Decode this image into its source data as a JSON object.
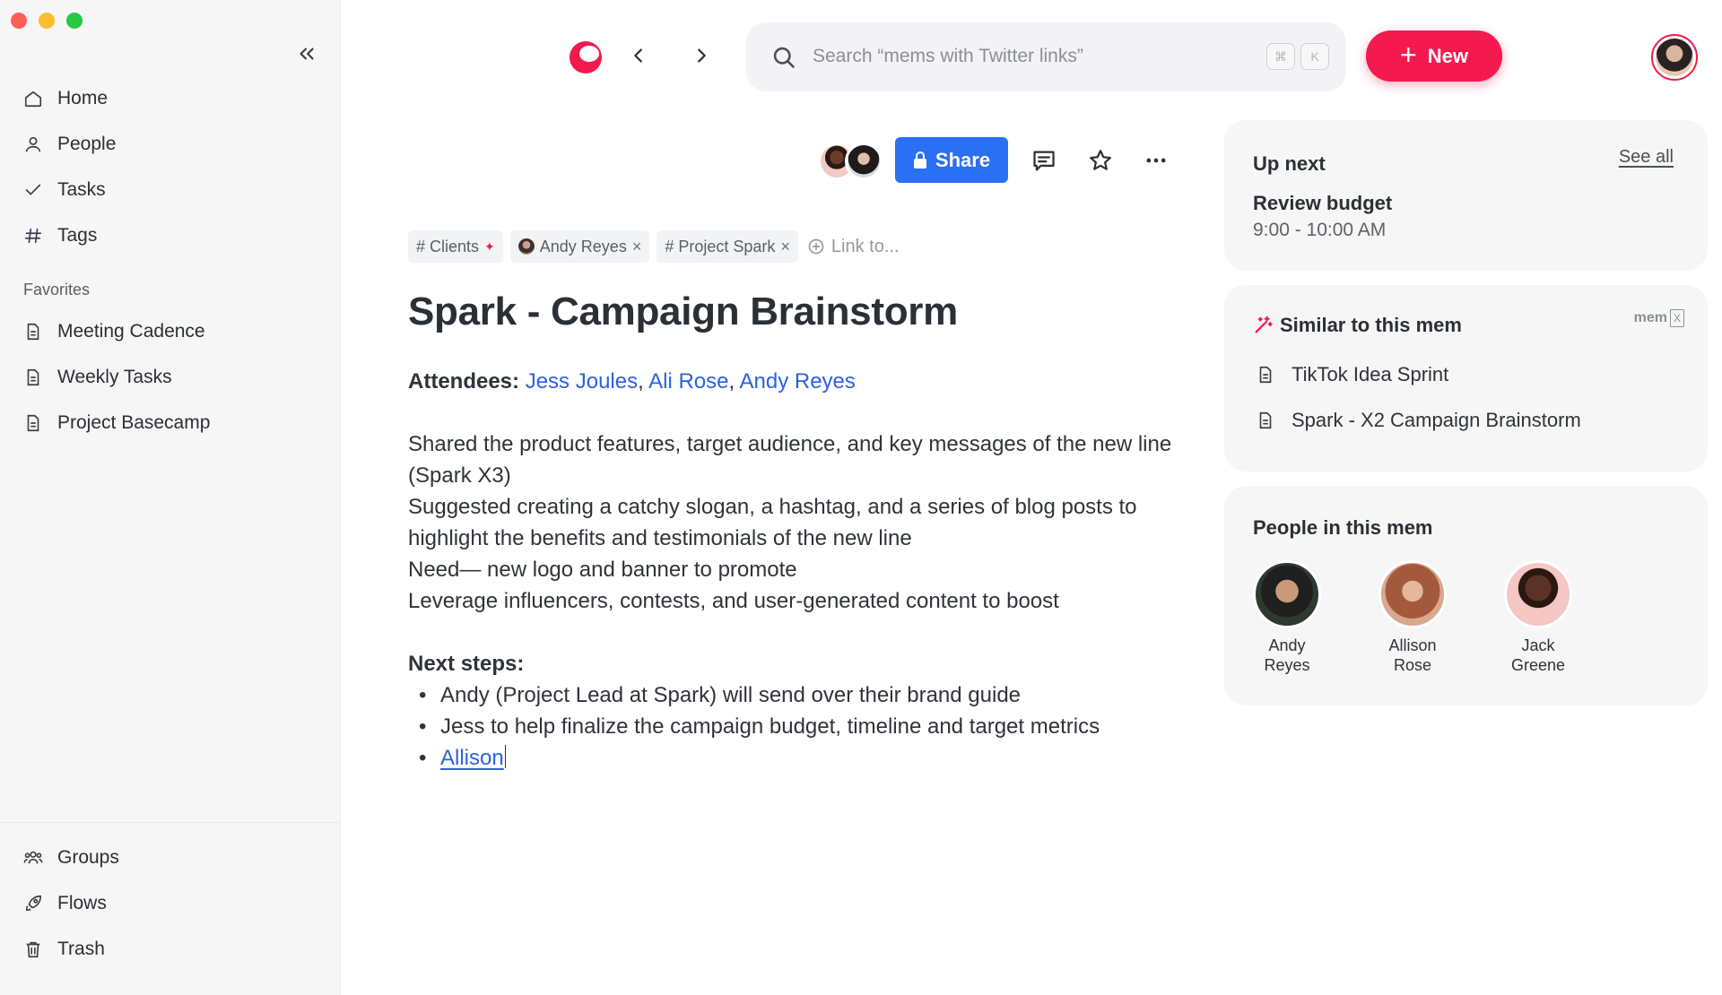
{
  "window": {
    "traffic_colors": [
      "#ff5f57",
      "#febc2e",
      "#28c840"
    ]
  },
  "sidebar": {
    "collapse_icon": "chevrons-left-icon",
    "nav": [
      {
        "label": "Home",
        "icon": "home-icon"
      },
      {
        "label": "People",
        "icon": "person-icon"
      },
      {
        "label": "Tasks",
        "icon": "check-icon"
      },
      {
        "label": "Tags",
        "icon": "hash-icon"
      }
    ],
    "favorites_label": "Favorites",
    "favorites": [
      {
        "label": "Meeting Cadence",
        "icon": "document-icon"
      },
      {
        "label": "Weekly Tasks",
        "icon": "document-icon"
      },
      {
        "label": "Project Basecamp",
        "icon": "document-icon"
      }
    ],
    "bottom": [
      {
        "label": "Groups",
        "icon": "group-icon"
      },
      {
        "label": "Flows",
        "icon": "rocket-icon"
      },
      {
        "label": "Trash",
        "icon": "trash-icon"
      }
    ]
  },
  "topbar": {
    "search_placeholder": "Search “mems with Twitter links”",
    "shortcut_keys": [
      "⌘",
      "K"
    ],
    "new_label": "New",
    "accent": "#f4194f"
  },
  "toolbar": {
    "share_label": "Share",
    "share_color": "#2a6ff4"
  },
  "tags": [
    {
      "label": "# Clients"
    },
    {
      "label": "Andy Reyes"
    },
    {
      "label": "# Project Spark"
    }
  ],
  "link_to": "Link to...",
  "doc": {
    "title": "Spark - Campaign Brainstorm",
    "attendees_label": "Attendees:",
    "attendees": [
      "Jess Joules",
      "Ali Rose",
      "Andy Reyes"
    ],
    "lines": [
      "Shared the product features, target audience, and key messages of the new line (Spark X3)",
      "Suggested creating a catchy slogan, a hashtag, and a series of blog posts to highlight the benefits and testimonials of the new line",
      "Need— new logo and banner to promote",
      "Leverage influencers, contests, and user-generated content to boost"
    ],
    "next_steps_label": "Next steps:",
    "next_steps": [
      "Andy (Project Lead at Spark) will send over their brand guide",
      "Jess to help finalize the campaign budget, timeline and target metrics"
    ],
    "mention": "Allison"
  },
  "up_next": {
    "title": "Up next",
    "see_all": "See all",
    "event_title": "Review budget",
    "event_time": "9:00 - 10:00 AM"
  },
  "similar": {
    "title": "Similar to this mem",
    "badge": "mem",
    "badge_box": "X",
    "items": [
      "TikTok Idea Sprint",
      "Spark - X2 Campaign Brainstorm"
    ]
  },
  "people": {
    "title": "People in this mem",
    "list": [
      {
        "first": "Andy",
        "last": "Reyes"
      },
      {
        "first": "Allison",
        "last": "Rose"
      },
      {
        "first": "Jack",
        "last": "Greene"
      }
    ]
  }
}
